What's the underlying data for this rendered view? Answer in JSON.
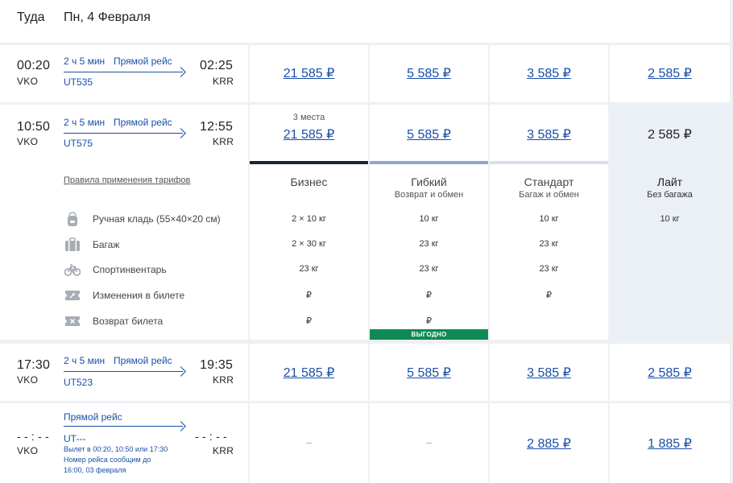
{
  "header": {
    "direction": "Туда",
    "date": "Пн, 4 Февраля"
  },
  "flights": [
    {
      "dep_time": "00:20",
      "dep_airport": "VKO",
      "duration": "2 ч 5 мин",
      "type": "Прямой рейс",
      "arr_time": "02:25",
      "arr_airport": "KRR",
      "flight_no": "UT535",
      "prices": [
        "21 585 ₽",
        "5 585 ₽",
        "3 585 ₽",
        "2 585 ₽"
      ]
    },
    {
      "dep_time": "10:50",
      "dep_airport": "VKO",
      "duration": "2 ч 5 мин",
      "type": "Прямой рейс",
      "arr_time": "12:55",
      "arr_airport": "KRR",
      "flight_no": "UT575",
      "seats": "3 места",
      "prices": [
        "21 585 ₽",
        "5 585 ₽",
        "3 585 ₽",
        "2 585 ₽"
      ]
    },
    {
      "dep_time": "17:30",
      "dep_airport": "VKO",
      "duration": "2 ч 5 мин",
      "type": "Прямой рейс",
      "arr_time": "19:35",
      "arr_airport": "KRR",
      "flight_no": "UT523",
      "prices": [
        "21 585 ₽",
        "5 585 ₽",
        "3 585 ₽",
        "2 585 ₽"
      ]
    },
    {
      "dep_time": "- - : - -",
      "dep_airport": "VKO",
      "type": "Прямой рейс",
      "arr_time": "- - : - -",
      "arr_airport": "KRR",
      "flight_no": "UT---",
      "note_lines": [
        "Вылет в 00:20, 10:50 или 17:30",
        "Номер рейса сообщим до",
        "16:00, 03 февраля"
      ],
      "prices": [
        "–",
        "–",
        "2 885 ₽",
        "1 885 ₽"
      ]
    }
  ],
  "tariffs": {
    "rules_link": "Правила применения тарифов",
    "columns": [
      {
        "name": "Бизнес",
        "sub": "",
        "bar_color": "#1c2530"
      },
      {
        "name": "Гибкий",
        "sub": "Возврат и обмен",
        "bar_color": "#8aa6d2",
        "badge": "ВЫГОДНО"
      },
      {
        "name": "Стандарт",
        "sub": "Багаж и обмен",
        "bar_color": "#d7dfea"
      },
      {
        "name": "Лайт",
        "sub": "Без багажа",
        "bar_color": ""
      }
    ],
    "features": [
      {
        "label": "Ручная кладь (55×40×20 см)",
        "icon": "backpack-icon",
        "values": [
          "2 × 10 кг",
          "10 кг",
          "10 кг",
          "10 кг"
        ]
      },
      {
        "label": "Багаж",
        "icon": "suitcase-icon",
        "values": [
          "2 × 30 кг",
          "23 кг",
          "23 кг",
          ""
        ]
      },
      {
        "label": "Спортинвентарь",
        "icon": "bicycle-icon",
        "values": [
          "23 кг",
          "23 кг",
          "23 кг",
          ""
        ]
      },
      {
        "label": "Изменения в билете",
        "icon": "ticket-change-icon",
        "values": [
          "₽",
          "₽",
          "₽",
          ""
        ]
      },
      {
        "label": "Возврат билета",
        "icon": "ticket-refund-icon",
        "values": [
          "₽",
          "₽",
          "",
          ""
        ]
      }
    ]
  },
  "colors": {
    "link": "#1a4fa8",
    "highlight": "#ebf0f7",
    "badge": "#0f8a55"
  }
}
